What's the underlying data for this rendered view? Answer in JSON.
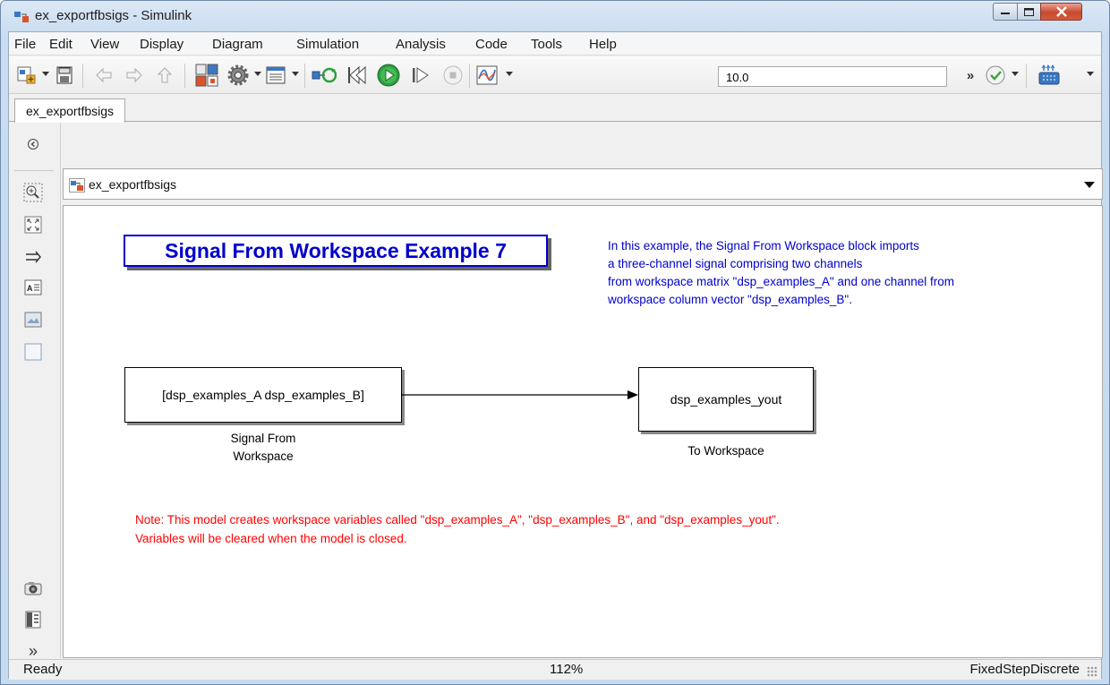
{
  "window": {
    "title": "ex_exportfbsigs - Simulink"
  },
  "menu": {
    "items": [
      "File",
      "Edit",
      "View",
      "Display",
      "Diagram",
      "Simulation",
      "Analysis",
      "Code",
      "Tools",
      "Help"
    ]
  },
  "toolbar": {
    "stop_time": "10.0",
    "overflow_label": "»"
  },
  "tabs": [
    {
      "label": "ex_exportfbsigs"
    }
  ],
  "address": {
    "path": "ex_exportfbsigs"
  },
  "canvas": {
    "title": "Signal From Workspace Example 7",
    "description": "In this example, the Signal From Workspace block imports\na three-channel signal comprising two channels\nfrom workspace matrix \"dsp_examples_A\" and one channel from\nworkspace column vector \"dsp_examples_B\".",
    "source_block": {
      "parameter": "[dsp_examples_A dsp_examples_B]",
      "name_line1": "Signal From",
      "name_line2": "Workspace"
    },
    "sink_block": {
      "parameter": "dsp_examples_yout",
      "name": "To Workspace"
    },
    "note": "Note: This model creates workspace variables called \"dsp_examples_A\", \"dsp_examples_B\", and \"dsp_examples_yout\".\nVariables will be cleared when the model is closed."
  },
  "palette": {
    "more_label": "»"
  },
  "status": {
    "state": "Ready",
    "zoom": "112%",
    "solver": "FixedStepDiscrete"
  },
  "colors": {
    "annotation_blue": "#0000cc",
    "note_red": "#ff0000"
  }
}
